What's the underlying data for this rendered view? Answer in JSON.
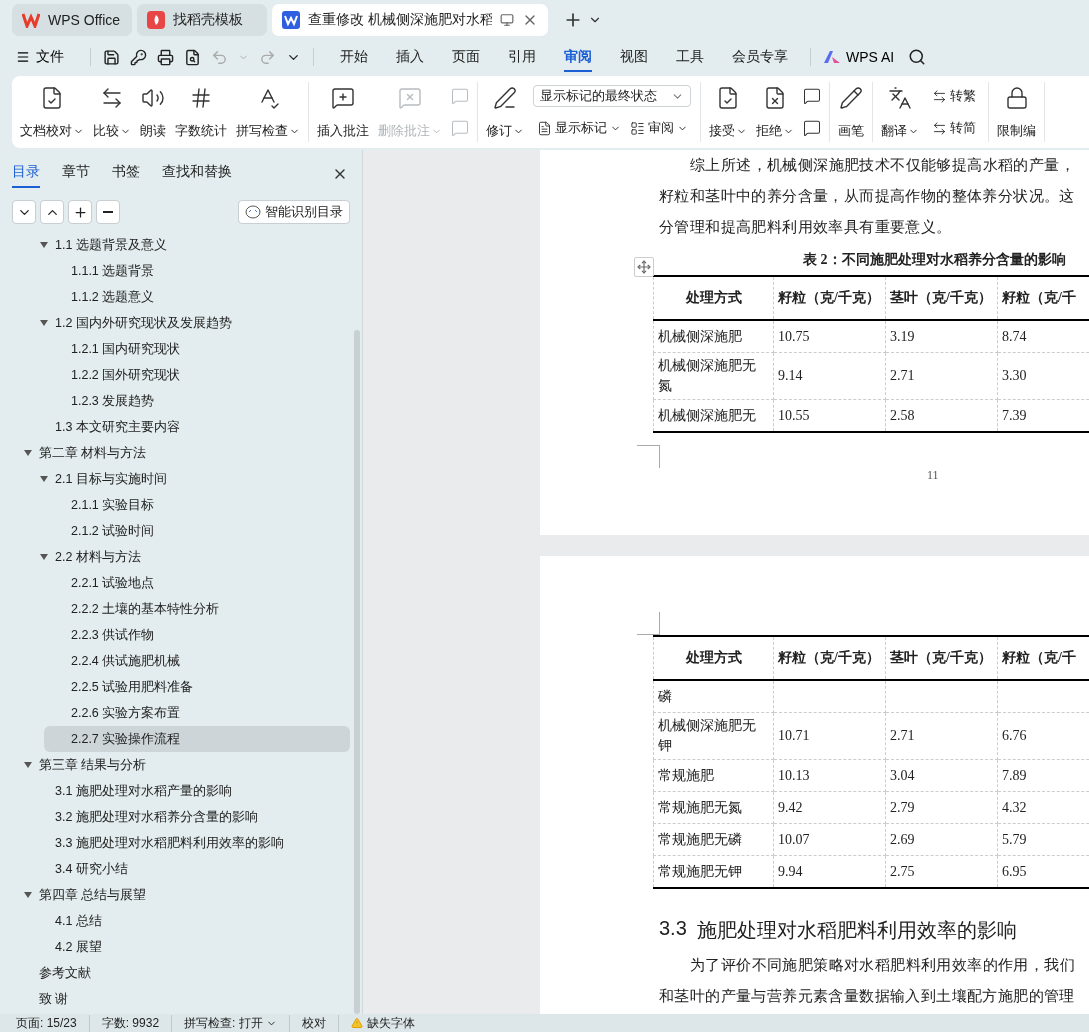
{
  "app_tabs": [
    {
      "label": "WPS Office",
      "selected": false
    },
    {
      "label": "找稻壳模板",
      "selected": false
    },
    {
      "label": "查重修改 机械侧深施肥对水稻",
      "selected": true
    }
  ],
  "menu": {
    "file": "文件",
    "tabs": [
      {
        "label": "开始",
        "selected": false
      },
      {
        "label": "插入",
        "selected": false
      },
      {
        "label": "页面",
        "selected": false
      },
      {
        "label": "引用",
        "selected": false
      },
      {
        "label": "审阅",
        "selected": true
      },
      {
        "label": "视图",
        "selected": false
      },
      {
        "label": "工具",
        "selected": false
      },
      {
        "label": "会员专享",
        "selected": false
      }
    ],
    "ai": "WPS AI"
  },
  "ribbon": {
    "groups": [
      {
        "items": [
          {
            "kind": "large",
            "label": "文档校对",
            "dropdown": true,
            "disabled": false
          },
          {
            "kind": "large",
            "label": "比较",
            "dropdown": true,
            "disabled": false
          },
          {
            "kind": "large",
            "label": "朗读",
            "dropdown": false,
            "disabled": false
          },
          {
            "kind": "large",
            "label": "字数统计",
            "dropdown": false,
            "disabled": false
          },
          {
            "kind": "large",
            "label": "拼写检查",
            "dropdown": true,
            "disabled": false
          }
        ]
      },
      {
        "items": [
          {
            "kind": "large",
            "label": "插入批注",
            "dropdown": false,
            "disabled": false
          },
          {
            "kind": "large",
            "label": "删除批注",
            "dropdown": true,
            "disabled": true
          },
          {
            "kind": "icon_column",
            "disabled": true
          }
        ]
      },
      {
        "items": [
          {
            "kind": "large",
            "label": "修订",
            "dropdown": true,
            "disabled": false
          },
          {
            "kind": "select_column",
            "select": {
              "value": "显示标记的最终状态"
            },
            "buttons": [
              {
                "label": "显示标记",
                "dropdown": true
              },
              {
                "label": "审阅",
                "dropdown": true
              }
            ]
          }
        ]
      },
      {
        "items": [
          {
            "kind": "large",
            "label": "接受",
            "dropdown": true,
            "disabled": false
          },
          {
            "kind": "large",
            "label": "拒绝",
            "dropdown": true,
            "disabled": false
          },
          {
            "kind": "icon_column",
            "disabled": false
          }
        ]
      },
      {
        "items": [
          {
            "kind": "large",
            "label": "画笔",
            "dropdown": false,
            "disabled": false
          }
        ]
      },
      {
        "items": [
          {
            "kind": "large",
            "label": "翻译",
            "dropdown": true,
            "disabled": false
          },
          {
            "kind": "small_column",
            "buttons": [
              {
                "label": "转繁",
                "dropdown": false
              },
              {
                "label": "转简",
                "dropdown": false
              }
            ]
          }
        ]
      },
      {
        "items": [
          {
            "kind": "large",
            "label": "限制编",
            "dropdown": false,
            "disabled": false
          }
        ]
      }
    ]
  },
  "sidebar": {
    "tabs": [
      {
        "label": "目录",
        "selected": true
      },
      {
        "label": "章节",
        "selected": false
      },
      {
        "label": "书签",
        "selected": false
      },
      {
        "label": "查找和替换",
        "selected": false
      }
    ],
    "smart_button": "智能识别目录",
    "outline_continued": [
      {
        "label": "1.1 选题背景及意义",
        "selected": false,
        "expanded": true,
        "children": [
          {
            "label": "1.1.1 选题背景",
            "selected": false
          },
          {
            "label": "1.1.2 选题意义",
            "selected": false
          }
        ]
      },
      {
        "label": "1.2  国内外研究现状及发展趋势",
        "selected": false,
        "expanded": true,
        "children": [
          {
            "label": "1.2.1  国内研究现状",
            "selected": false
          },
          {
            "label": "1.2.2  国外研究现状",
            "selected": false
          },
          {
            "label": "1.2.3  发展趋势",
            "selected": false
          }
        ]
      },
      {
        "label": "1.3  本文研究主要内容",
        "selected": false
      }
    ],
    "outline": [
      {
        "label": "第二章  材料与方法",
        "selected": false,
        "expanded": true,
        "children": [
          {
            "label": "2.1  目标与实施时间",
            "selected": false,
            "expanded": true,
            "children": [
              {
                "label": "2.1.1  实验目标",
                "selected": false
              },
              {
                "label": "2.1.2  试验时间",
                "selected": false
              }
            ]
          },
          {
            "label": "2.2 材料与方法",
            "selected": false,
            "expanded": true,
            "children": [
              {
                "label": "2.2.1 试验地点",
                "selected": false
              },
              {
                "label": "2.2.2  土壤的基本特性分析",
                "selected": false
              },
              {
                "label": "2.2.3  供试作物",
                "selected": false
              },
              {
                "label": "2.2.4  供试施肥机械",
                "selected": false
              },
              {
                "label": "2.2.5  试验用肥料准备",
                "selected": false
              },
              {
                "label": "2.2.6  实验方案布置",
                "selected": false
              },
              {
                "label": "2.2.7  实验操作流程",
                "selected": true
              }
            ]
          }
        ]
      },
      {
        "label": "第三章  结果与分析",
        "selected": false,
        "expanded": true,
        "children": [
          {
            "label": "3.1  施肥处理对水稻产量的影响",
            "selected": false
          },
          {
            "label": "3.2  施肥处理对水稻养分含量的影响",
            "selected": false
          },
          {
            "label": "3.3  施肥处理对水稻肥料利用效率的影响",
            "selected": false
          },
          {
            "label": "3.4  研究小结",
            "selected": false
          }
        ]
      },
      {
        "label": "第四章  总结与展望",
        "selected": false,
        "expanded": true,
        "children": [
          {
            "label": "4.1  总结",
            "selected": false
          },
          {
            "label": "4.2  展望",
            "selected": false
          }
        ]
      },
      {
        "label": "参考文献",
        "selected": false
      },
      {
        "label": "致    谢",
        "selected": false
      }
    ]
  },
  "document": {
    "page1": {
      "paragraph_lines": [
        "综上所述，机械侧深施肥技术不仅能够提高水稻的产量，",
        "籽粒和茎叶中的养分含量，从而提高作物的整体养分状况。这",
        "分管理和提高肥料利用效率具有重要意义。"
      ],
      "caption": "表 2：不同施肥处理对水稻养分含量的影响",
      "table": {
        "columns": [
          "处理方式",
          "籽粒（克/千克）",
          "茎叶（克/千克）",
          "籽粒（克/千"
        ],
        "rows": [
          {
            "cells": [
              "机械侧深施肥",
              "10.75",
              "3.19",
              "8.74"
            ]
          },
          {
            "cells": [
              "机械侧深施肥无氮",
              "9.14",
              "2.71",
              "3.30"
            ]
          },
          {
            "cells": [
              "机械侧深施肥无",
              "10.55",
              "2.58",
              "7.39"
            ]
          }
        ]
      },
      "page_number": "11"
    },
    "page2": {
      "table": {
        "columns": [
          "处理方式",
          "籽粒（克/千克）",
          "茎叶（克/千克）",
          "籽粒（克/千"
        ],
        "rows": [
          {
            "cells": [
              "磷"
            ]
          },
          {
            "cells": [
              "机械侧深施肥无钾",
              "10.71",
              "2.71",
              "6.76"
            ]
          },
          {
            "cells": [
              "常规施肥",
              "10.13",
              "3.04",
              "7.89"
            ]
          },
          {
            "cells": [
              "常规施肥无氮",
              "9.42",
              "2.79",
              "4.32"
            ]
          },
          {
            "cells": [
              "常规施肥无磷",
              "10.07",
              "2.69",
              "5.79"
            ]
          },
          {
            "cells": [
              "常规施肥无钾",
              "9.94",
              "2.75",
              "6.95"
            ]
          }
        ]
      },
      "heading_number": "3.3",
      "heading": "施肥处理对水稻肥料利用效率的影响",
      "paragraph_lines": [
        "为了评价不同施肥策略对水稻肥料利用效率的作用，我们",
        "和茎叶的产量与营养元素含量数据输入到土壤配方施肥的管理"
      ]
    }
  },
  "status_bar": {
    "page": "页面: 15/23",
    "words": "字数: 9932",
    "spell": "拼写检查: 打开",
    "proof": "校对",
    "missing_fonts": "缺失字体"
  }
}
